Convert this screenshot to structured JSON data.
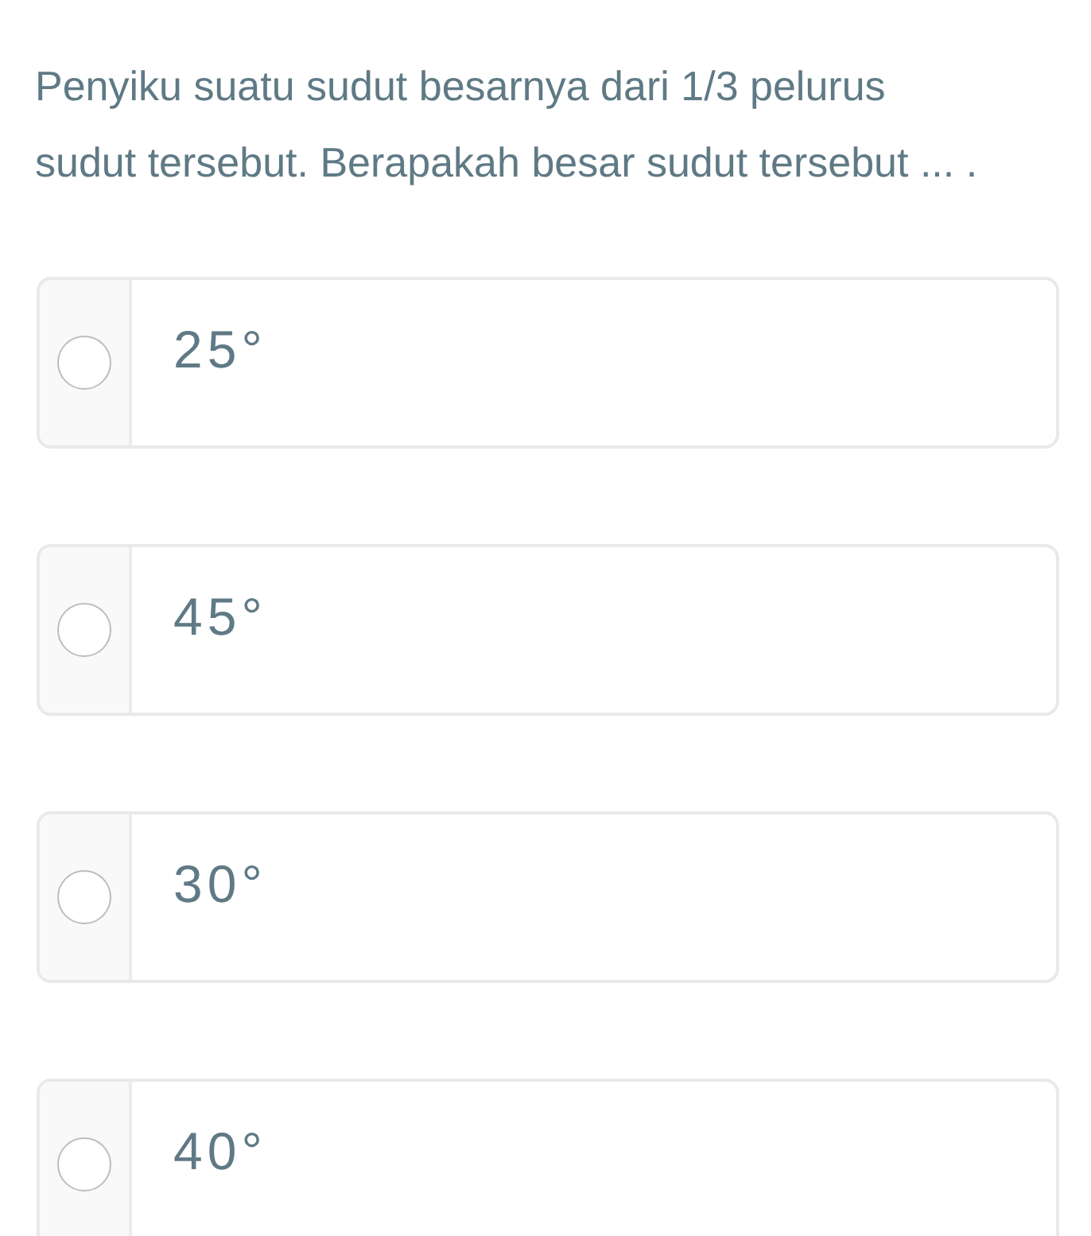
{
  "question": "Penyiku suatu sudut besarnya dari 1/3 pelurus sudut tersebut. Berapakah besar sudut tersebut ... .",
  "options": [
    {
      "label": "25°",
      "selected": false
    },
    {
      "label": "45°",
      "selected": false
    },
    {
      "label": "30°",
      "selected": false
    },
    {
      "label": "40°",
      "selected": false
    }
  ]
}
